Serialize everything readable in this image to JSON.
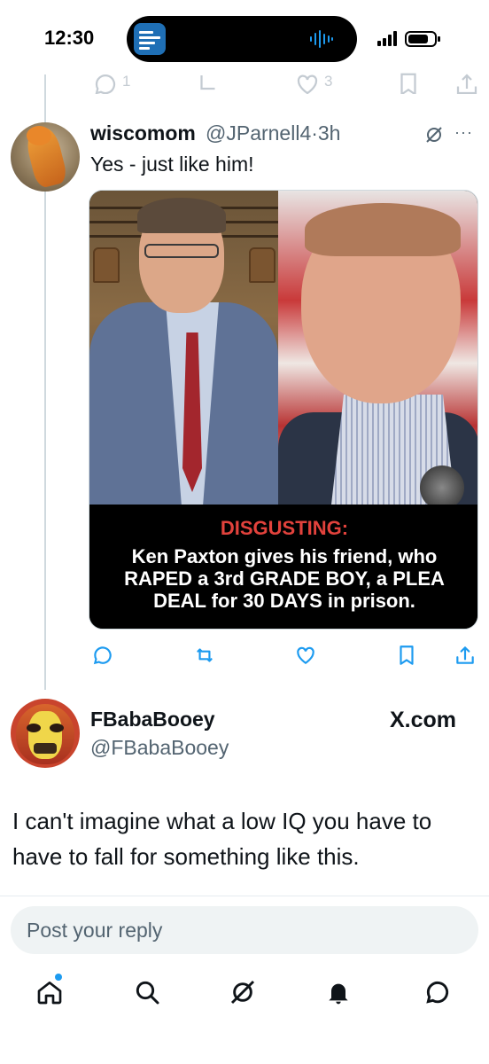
{
  "status_bar": {
    "time": "12:30"
  },
  "previous_tweet": {
    "reply_count": "1",
    "like_count": "3"
  },
  "tweet": {
    "author_name": "wiscomom",
    "author_handle": "@JParnell4·3h",
    "text": "Yes - just like him!",
    "image": {
      "caption_heading": "DISGUSTING:",
      "caption_body": "Ken Paxton gives his friend, who RAPED a 3rd GRADE BOY, a PLEA DEAL for 30 DAYS in prison."
    },
    "actions": {
      "reply_icon": "reply-icon",
      "repost_icon": "repost-icon",
      "like_icon": "heart-icon",
      "bookmark_icon": "bookmark-icon",
      "share_icon": "share-icon"
    }
  },
  "reply": {
    "author_name": "FBabaBooey",
    "author_handle": "@FBabaBooey",
    "source_badge": "X.com",
    "text": "I can't imagine what a low IQ you have to have to fall for something like this."
  },
  "compose": {
    "placeholder": "Post your reply"
  },
  "nav": {
    "items": [
      "home-icon",
      "search-icon",
      "grok-icon",
      "notifications-icon",
      "messages-icon"
    ]
  },
  "colors": {
    "accent": "#1d9bf0",
    "text_primary": "#0f1419",
    "text_secondary": "#536471",
    "caption_red": "#e2423c"
  }
}
